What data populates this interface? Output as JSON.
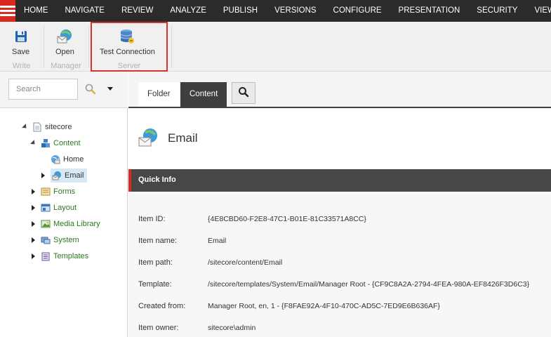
{
  "nav": {
    "items": [
      "HOME",
      "NAVIGATE",
      "REVIEW",
      "ANALYZE",
      "PUBLISH",
      "VERSIONS",
      "CONFIGURE",
      "PRESENTATION",
      "SECURITY",
      "VIEW"
    ]
  },
  "ribbon": {
    "chunks": [
      {
        "title": "Write",
        "buttons": [
          {
            "label": "Save",
            "icon": "save-icon"
          }
        ]
      },
      {
        "title": "Manager",
        "buttons": [
          {
            "label": "Open",
            "icon": "email-manager-icon"
          }
        ]
      },
      {
        "title": "Server",
        "buttons": [
          {
            "label": "Test Connection",
            "icon": "database-server-icon"
          }
        ]
      }
    ]
  },
  "search": {
    "placeholder": "Search"
  },
  "tree": {
    "nodes": [
      {
        "label": "sitecore",
        "icon": "document-icon",
        "state": "expanded",
        "color": "#333333"
      },
      {
        "label": "Content",
        "icon": "cubes-icon",
        "state": "expanded",
        "color": "#2b7a1f"
      },
      {
        "label": "Home",
        "icon": "globe-icon",
        "state": "leaf",
        "color": "#333333"
      },
      {
        "label": "Email",
        "icon": "email-icon",
        "state": "collapsed",
        "selected": true,
        "color": "#333333"
      },
      {
        "label": "Forms",
        "icon": "forms-icon",
        "state": "collapsed",
        "color": "#2b7a1f"
      },
      {
        "label": "Layout",
        "icon": "layout-icon",
        "state": "collapsed",
        "color": "#2b7a1f"
      },
      {
        "label": "Media Library",
        "icon": "image-icon",
        "state": "collapsed",
        "color": "#2b7a1f"
      },
      {
        "label": "System",
        "icon": "system-icon",
        "state": "collapsed",
        "color": "#2b7a1f"
      },
      {
        "label": "Templates",
        "icon": "templates-icon",
        "state": "collapsed",
        "color": "#2b7a1f"
      }
    ]
  },
  "tabs": {
    "folder": "Folder",
    "content": "Content"
  },
  "item": {
    "title": "Email"
  },
  "quickinfo": {
    "title": "Quick Info",
    "rows": [
      {
        "key": "Item ID:",
        "value": "{4E8CBD60-F2E8-47C1-B01E-81C33571A8CC}"
      },
      {
        "key": "Item name:",
        "value": "Email"
      },
      {
        "key": "Item path:",
        "value": "/sitecore/content/Email"
      },
      {
        "key": "Template:",
        "value": "/sitecore/templates/System/Email/Manager Root - {CF9C8A2A-2794-4FEA-980A-EF8426F3D6C3}"
      },
      {
        "key": "Created from:",
        "value": "Manager Root, en, 1 - {F8FAE92A-4F10-470C-AD5C-7ED9E6B636AF}"
      },
      {
        "key": "Item owner:",
        "value": "sitecore\\admin"
      }
    ]
  },
  "colors": {
    "accent": "#dc291e",
    "nav_bg": "#2b2b2b",
    "section_bg": "#474747",
    "tree_green": "#2b7a1f",
    "selection": "#d7e9f7"
  }
}
